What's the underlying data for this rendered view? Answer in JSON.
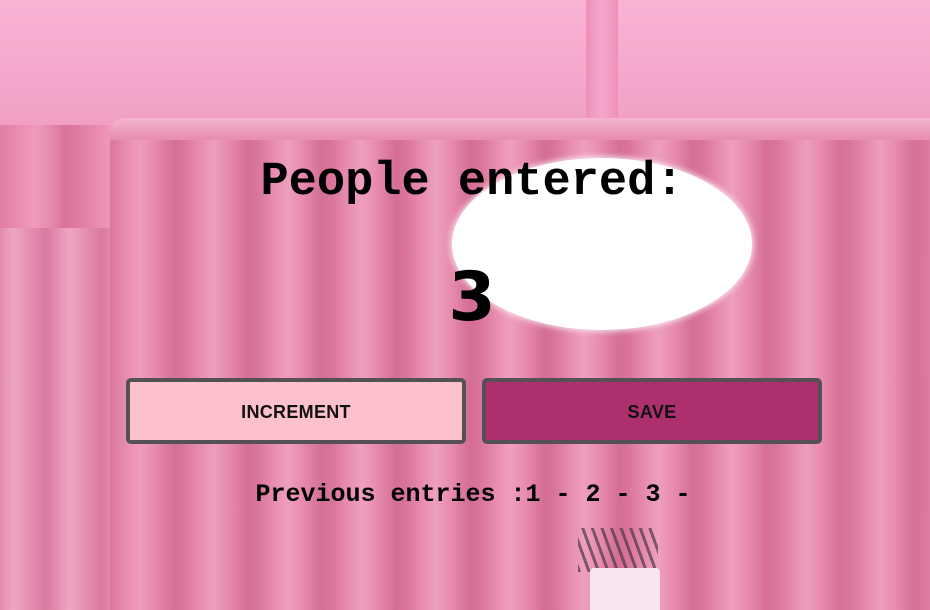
{
  "heading": "People entered:",
  "count": "3",
  "buttons": {
    "increment_label": "INCREMENT",
    "save_label": "SAVE"
  },
  "entries_text": "Previous entries :1 - 2 - 3 -",
  "colors": {
    "increment_bg": "#fcc1cc",
    "save_bg": "#ae2f6e",
    "button_border": "#555055"
  }
}
